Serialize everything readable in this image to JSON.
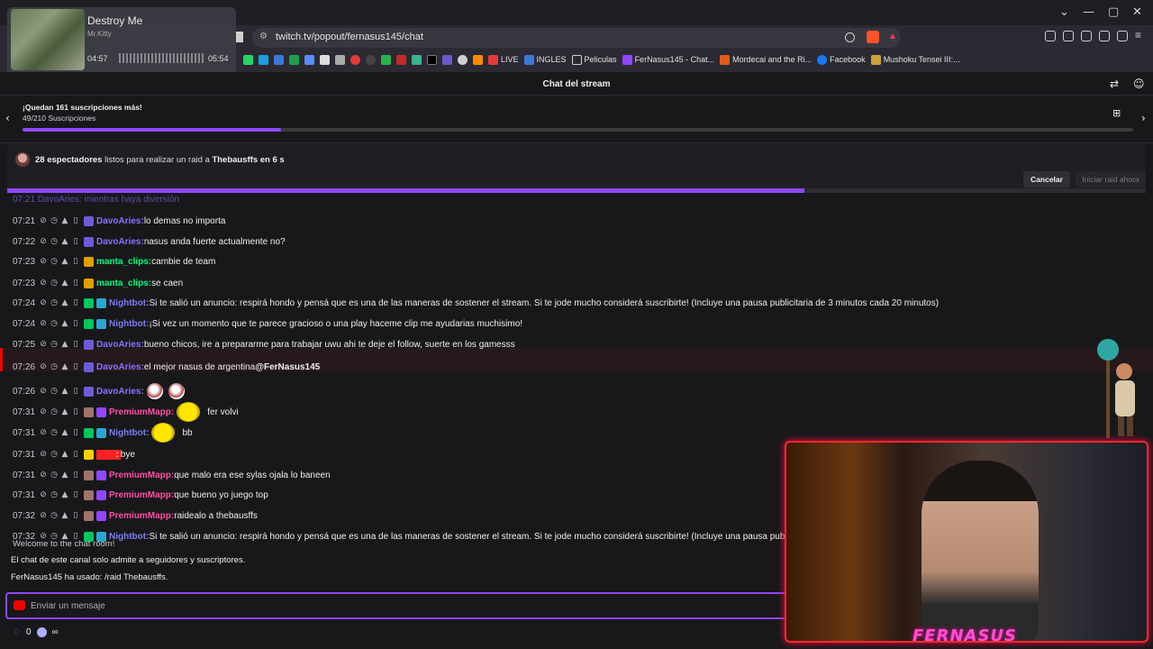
{
  "browser": {
    "url": "twitch.tv/popout/fernasus145/chat",
    "bookmarks": [
      "LIVE",
      "INGLES",
      "Peliculas",
      "FerNasus145 - Chat...",
      "Mordecai and the Ri...",
      "Facebook",
      "Mushoku Tensei III:..."
    ]
  },
  "media": {
    "title": "Destroy Me",
    "artist": "Mr.Kitty",
    "current_time": "04:57",
    "total_time": "05:54",
    "progress": 0.84
  },
  "chat": {
    "title": "Chat del stream",
    "sub_goal": {
      "title": "¡Quedan 161 suscripciones más!",
      "count": "49/210 Suscripciones",
      "progress": 0.233
    },
    "raid": {
      "viewers": "28 espectadores",
      "text_mid": " listos para realizar un raid a ",
      "target": "Thebausffs en 6 s",
      "cancel": "Cancelar",
      "raid_now": "Iniciar raid ahora",
      "progress": 0.7
    },
    "partial_message": "07:21 DavoAries: mientras haya diversión",
    "messages": [
      {
        "time": "07:21",
        "user": "DavoAries",
        "color": "#8a71ff",
        "text": "lo demas no importa"
      },
      {
        "time": "07:22",
        "user": "DavoAries",
        "color": "#8a71ff",
        "text": "nasus anda fuerte actualmente no?"
      },
      {
        "time": "07:23",
        "user": "manta_clips",
        "color": "#00ff7f",
        "text": "cambie de team"
      },
      {
        "time": "07:23",
        "user": "manta_clips",
        "color": "#00ff7f",
        "text": "se caen"
      },
      {
        "time": "07:24",
        "user": "Nightbot",
        "color": "#7c7cf1",
        "text": "Si te salió un anuncio: respirá hondo y pensá que es una de las maneras de sostener el stream. Si te jode mucho considerá suscribirte! (Incluye una pausa publicitaria de 3 minutos cada 20 minutos)"
      },
      {
        "time": "07:24",
        "user": "Nightbot",
        "color": "#7c7cf1",
        "text": "¡Si vez un momento que te parece gracioso o una play haceme clip me ayudarias muchisimo!"
      },
      {
        "time": "07:25",
        "user": "DavoAries",
        "color": "#8a71ff",
        "text": "bueno chicos, ire a prepararme para trabajar uwu ahi te deje el follow, suerte en los gamesss"
      },
      {
        "time": "07:26",
        "user": "DavoAries",
        "color": "#8a71ff",
        "text": "el mejor nasus de argentina ",
        "mention": "@FerNasus145"
      },
      {
        "time": "07:26",
        "user": "DavoAries",
        "color": "#8a71ff",
        "text": ""
      },
      {
        "time": "07:31",
        "user": "PremiumMapp",
        "color": "#ff4fa3",
        "text": "fer volvi"
      },
      {
        "time": "07:31",
        "user": "Nightbot",
        "color": "#7c7cf1",
        "text": "bb"
      },
      {
        "time": "07:31",
        "user": "",
        "color": "#ff2222",
        "text": "bye"
      },
      {
        "time": "07:31",
        "user": "PremiumMapp",
        "color": "#ff4fa3",
        "text": "que malo era ese sylas ojala lo baneen"
      },
      {
        "time": "07:31",
        "user": "PremiumMapp",
        "color": "#ff4fa3",
        "text": "que bueno yo juego top"
      },
      {
        "time": "07:32",
        "user": "PremiumMapp",
        "color": "#ff4fa3",
        "text": "raidealo a thebausffs"
      },
      {
        "time": "07:32",
        "user": "Nightbot",
        "color": "#7c7cf1",
        "text": "Si te salió un anuncio: respirá hondo y pensá que es una de las maneras de sostener el stream. Si te jode mucho considerá suscribirte! (Incluye una pausa publici"
      }
    ],
    "system": {
      "welcome": "Welcome to the chat room!",
      "followers_only": "El chat de este canal solo admite a seguidores y suscriptores.",
      "raid_used": "FerNasus145 ha usado: /raid Thebausffs."
    },
    "input_placeholder": "Enviar un mensaje",
    "points": "0",
    "points_extra": "∞"
  },
  "webcam": {
    "banner": "FERNASUS"
  }
}
